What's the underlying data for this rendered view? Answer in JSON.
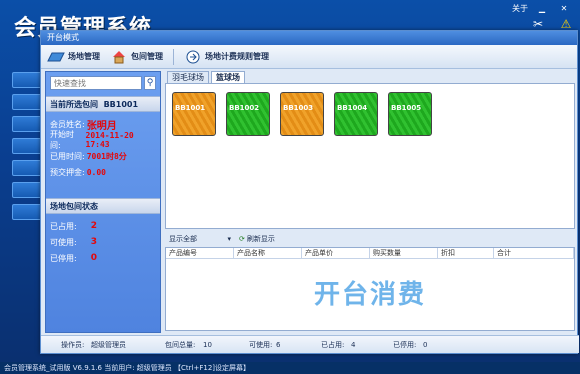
{
  "app": {
    "bg_title": "会员管理系统",
    "about": "关于",
    "statusbar": "会员管理系统_试用版  V6.9.1.6  当前用户: 超级管理员  【Ctrl+F12]设定屏幕】"
  },
  "dialog": {
    "title": "开台模式",
    "toolbar": {
      "venue_manage": "场地管理",
      "room_manage": "包间管理",
      "pricing_rules": "场地计费规则管理"
    }
  },
  "left": {
    "search_placeholder": "快速查找",
    "current_room_label": "当前所选包间",
    "current_room": "BB1001",
    "member_name_label": "会员姓名:",
    "member_name": "张明月",
    "start_time_label": "开始时间:",
    "start_time": "2014-11-20 17:43",
    "used_time_label": "已用时间:",
    "used_time": "7001时8分",
    "deposit_label": "预交押金:",
    "deposit": "0.00",
    "status_header": "场地包间状态",
    "occupied_label": "已占用:",
    "occupied": "2",
    "available_label": "可使用:",
    "available": "3",
    "disabled_label": "已停用:",
    "disabled": "0"
  },
  "venue_tabs": [
    "羽毛球场",
    "篮球场"
  ],
  "rooms": [
    {
      "id": "BB1001",
      "status": "occupied",
      "color": "#f0a22a"
    },
    {
      "id": "BB1002",
      "status": "available",
      "color": "#30c130"
    },
    {
      "id": "BB1003",
      "status": "occupied",
      "color": "#f0a22a"
    },
    {
      "id": "BB1004",
      "status": "available",
      "color": "#30c130"
    },
    {
      "id": "BB1005",
      "status": "available",
      "color": "#30c130"
    }
  ],
  "filter": {
    "show_all": "显示全部",
    "refresh": "刷新显示"
  },
  "grid": {
    "columns": [
      "产品编号",
      "产品名称",
      "产品单价",
      "购买数量",
      "折扣",
      "合计"
    ],
    "watermark": "开台消费"
  },
  "bottom": {
    "operator_label": "操作员:",
    "operator": "超级管理员",
    "total_label": "包间总量:",
    "total": "10",
    "available_label": "可使用:",
    "available": "6",
    "occupied_label": "已占用:",
    "occupied": "4",
    "disabled_label": "已停用:",
    "disabled": "0"
  }
}
